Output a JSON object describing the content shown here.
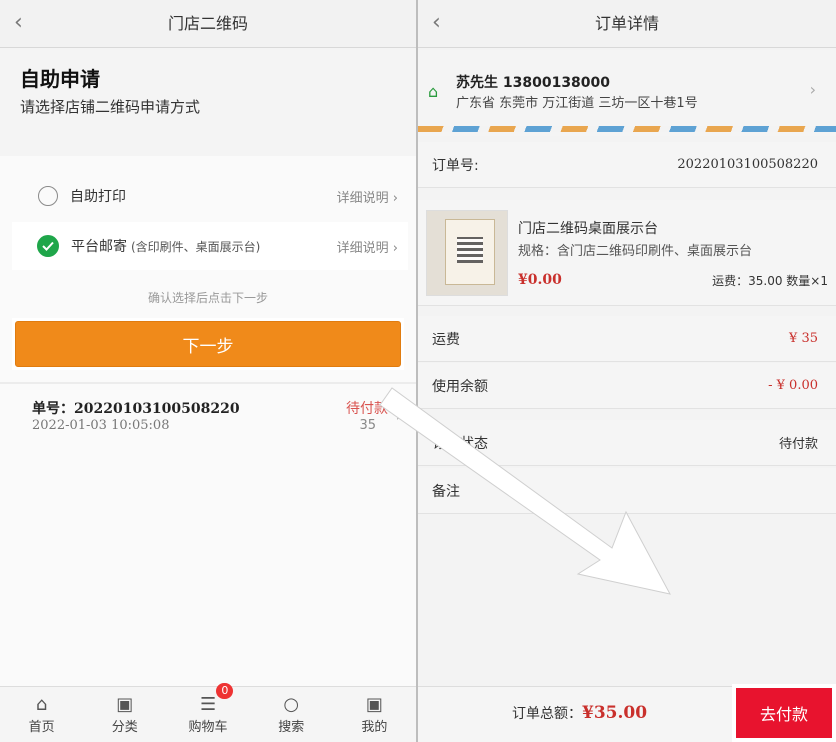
{
  "left": {
    "title": "门店二维码",
    "heading": "自助申请",
    "subheading": "请选择店铺二维码申请方式",
    "options": [
      {
        "label": "自助打印",
        "sub": "",
        "more": "详细说明"
      },
      {
        "label": "平台邮寄",
        "sub": "(含印刷件、桌面展示台)",
        "more": "详细说明"
      }
    ],
    "hint": "确认选择后点击下一步",
    "next": "下一步",
    "order": {
      "num": "单号：20220103100508220",
      "time": "2022-01-03 10:05:08",
      "status": "待付款",
      "amount": "35"
    },
    "tabs": [
      {
        "label": "首页",
        "icon": "home-icon"
      },
      {
        "label": "分类",
        "icon": "category-icon"
      },
      {
        "label": "购物车",
        "icon": "cart-icon",
        "badge": "0"
      },
      {
        "label": "搜索",
        "icon": "search-icon"
      },
      {
        "label": "我的",
        "icon": "profile-icon"
      }
    ]
  },
  "right": {
    "title": "订单详情",
    "addr": {
      "name": "苏先生   13800138000",
      "line": "广东省 东莞市 万江街道 三坊一区十巷1号"
    },
    "order_no_label": "订单号:",
    "order_no": "20220103100508220",
    "product": {
      "title": "门店二维码桌面展示台",
      "spec": "规格：含门店二维码印刷件、桌面展示台",
      "price": "¥0.00",
      "ship": "运费：35.00   数量×1"
    },
    "rows": [
      {
        "label": "运费",
        "value": "¥ 35"
      },
      {
        "label": "使用余额",
        "value": "- ¥ 0.00"
      },
      {
        "label": "订单状态",
        "value": "待付款"
      },
      {
        "label": "备注",
        "value": ""
      }
    ],
    "total_label": "订单总额：",
    "total_value": "¥35.00",
    "pay": "去付款"
  },
  "colors": {
    "accent": "#f08a1a",
    "pay": "#e8132e",
    "check": "#1fa64a",
    "price": "#c9302c"
  }
}
